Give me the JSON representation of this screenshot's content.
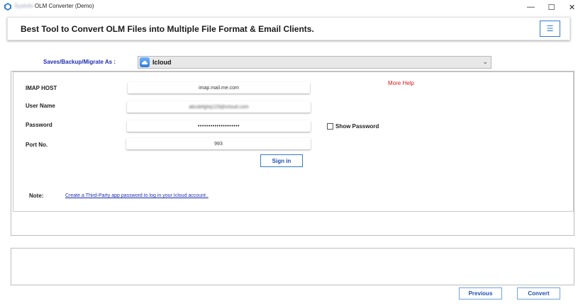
{
  "window": {
    "title_blurred_part": "SysInfo",
    "title": "OLM Converter (Demo)",
    "controls": {
      "minimize": "—",
      "maximize": "☐",
      "close": "✕"
    }
  },
  "banner": {
    "title": "Best Tool to Convert OLM Files into Multiple File Format & Email Clients.",
    "menu_icon": "☰"
  },
  "saves_as": {
    "label": "Saves/Backup/Migrate As :",
    "selected": "Icloud",
    "icon": "icloud-icon",
    "arrow": "⌄"
  },
  "form": {
    "imap_host": {
      "label": "IMAP HOST",
      "value": "imap.mail.me.com"
    },
    "username": {
      "label": "User Name",
      "value": "abcdefghij123@icloud.com"
    },
    "password": {
      "label": "Password",
      "value": "••••••••••••••••••••"
    },
    "port": {
      "label": "Port No.",
      "value": "993"
    },
    "more_help": "More Help",
    "show_password": "Show Password",
    "signin": "Sign in",
    "note_label": "Note:",
    "note_link": "Create a Third-Party app password to log in your Icloud account ."
  },
  "footer": {
    "previous": "Previous",
    "convert": "Convert"
  },
  "colors": {
    "accent": "#2f7ad6",
    "label_blue": "#1f2db5",
    "help_red": "#d81a1a"
  }
}
